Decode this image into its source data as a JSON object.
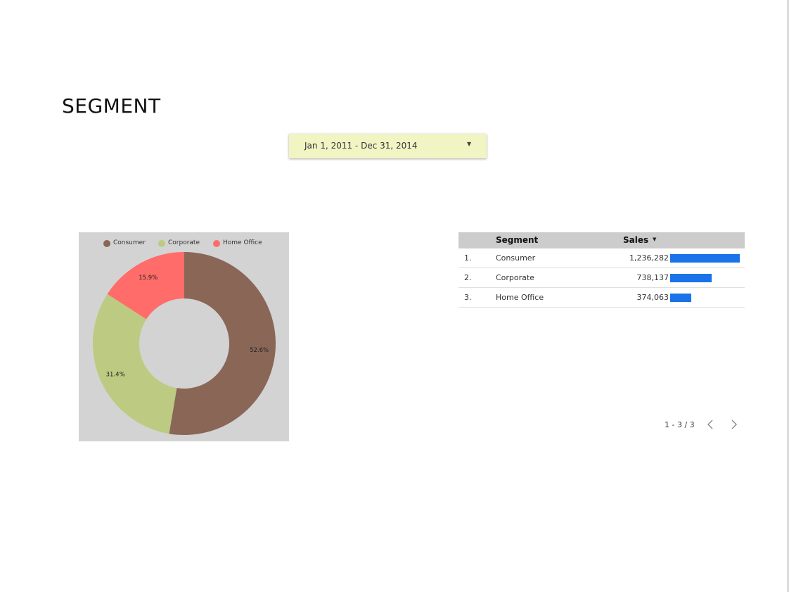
{
  "page": {
    "title": "SEGMENT"
  },
  "date_range": {
    "label": "Jan 1, 2011 - Dec 31, 2014",
    "caret_icon": "caret-down-icon"
  },
  "chart_data": {
    "type": "pie",
    "donut": true,
    "categories": [
      "Consumer",
      "Corporate",
      "Home Office"
    ],
    "values": [
      52.6,
      31.4,
      15.9
    ],
    "labels": [
      "52.6%",
      "31.4%",
      "15.9%"
    ],
    "colors": [
      "#8a6657",
      "#bccb81",
      "#ff6c69"
    ],
    "legend_position": "top",
    "background": "#d3d3d3"
  },
  "table": {
    "headers": {
      "segment": "Segment",
      "sales": "Sales"
    },
    "sort_icon": "caret-down-icon",
    "bar_color": "#1a73e8",
    "rows": [
      {
        "index": "1.",
        "segment": "Consumer",
        "sales": "1,236,282",
        "value": 1236282
      },
      {
        "index": "2.",
        "segment": "Corporate",
        "sales": "738,137",
        "value": 738137
      },
      {
        "index": "3.",
        "segment": "Home Office",
        "sales": "374,063",
        "value": 374063
      }
    ]
  },
  "pagination": {
    "label": "1 - 3 / 3",
    "prev_icon": "chevron-left-icon",
    "next_icon": "chevron-right-icon"
  }
}
